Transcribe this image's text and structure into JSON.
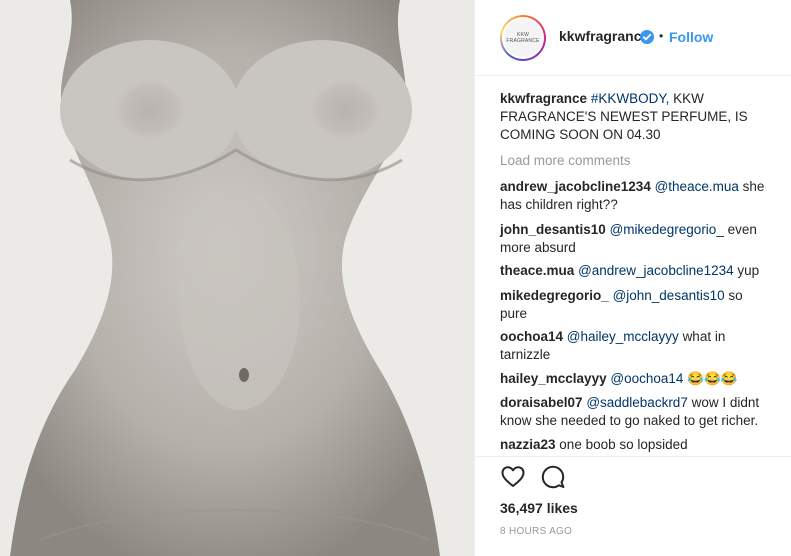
{
  "post": {
    "author": "kkwfragrance",
    "avatar_text": "KKW FRAGRANCE",
    "follow_label": "Follow",
    "separator": "•",
    "caption": {
      "user": "kkwfragrance",
      "hashtag": "#KKWBODY,",
      "text1": "KKW",
      "text2": "FRAGRANCE'S NEWEST PERFUME, IS",
      "text3": "COMING SOON ON 04.30"
    },
    "load_more": "Load more comments",
    "comments": [
      {
        "user": "andrew_jacobcline1234",
        "mention": "@theace.mua",
        "line1": "she",
        "line2": "has children right??"
      },
      {
        "user": "john_desantis10",
        "mention": "@mikedegregorio_",
        "line1": "even",
        "line2": "more absurd"
      },
      {
        "user": "theace.mua",
        "mention": "@andrew_jacobcline1234",
        "line1": "yup",
        "line2": ""
      },
      {
        "user": "mikedegregorio_",
        "mention": "@john_desantis10",
        "line1": "so",
        "line2": "pure"
      },
      {
        "user": "oochoa14",
        "mention": "@hailey_mcclayyy",
        "line1": "what in",
        "line2": "tarnizzle"
      },
      {
        "user": "hailey_mcclayyy",
        "mention": "@oochoa14",
        "line1": "😂😂😂",
        "line2": ""
      },
      {
        "user": "doraisabel07",
        "mention": "@saddlebackrd7",
        "line1": "wow I didnt",
        "line2": "know she needed to go naked to get richer."
      },
      {
        "user": "nazzia23",
        "mention": "",
        "line1": "one boob so lopsided",
        "line2": ""
      }
    ],
    "likes": "36,497 likes",
    "timestamp": "8 HOURS AGO",
    "icons": [
      "heart-icon",
      "comment-icon",
      "verified-badge-icon"
    ],
    "colors": {
      "link": "#3897f0",
      "mention": "#003569",
      "muted": "#999999"
    }
  }
}
